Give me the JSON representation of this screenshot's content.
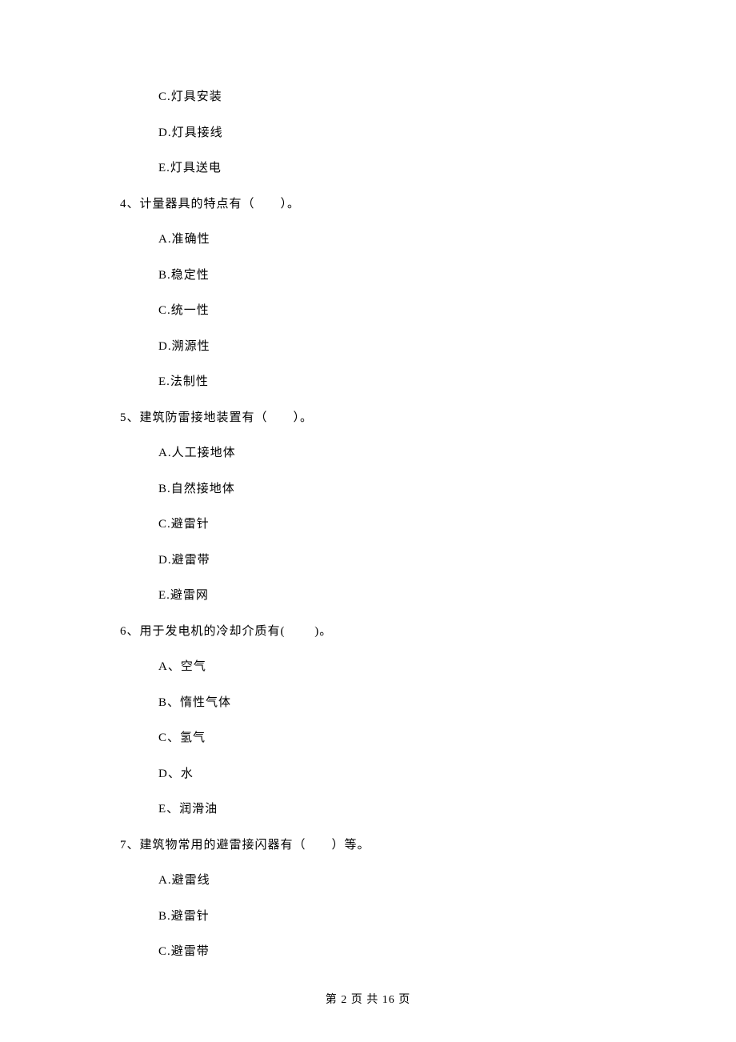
{
  "q3_options": {
    "c": "C.灯具安装",
    "d": "D.灯具接线",
    "e": "E.灯具送电"
  },
  "q4": {
    "text": "4、计量器具的特点有（　　）。",
    "a": "A.准确性",
    "b": "B.稳定性",
    "c": "C.统一性",
    "d": "D.溯源性",
    "e": "E.法制性"
  },
  "q5": {
    "text": "5、建筑防雷接地装置有（　　）。",
    "a": "A.人工接地体",
    "b": "B.自然接地体",
    "c": "C.避雷针",
    "d": "D.避雷带",
    "e": "E.避雷网"
  },
  "q6": {
    "text": "6、用于发电机的冷却介质有(　　 )。",
    "a": "A、空气",
    "b": "B、惰性气体",
    "c": "C、氢气",
    "d": "D、水",
    "e": "E、润滑油"
  },
  "q7": {
    "text": "7、建筑物常用的避雷接闪器有（　　）等。",
    "a": "A.避雷线",
    "b": "B.避雷针",
    "c": "C.避雷带"
  },
  "footer": "第 2 页 共 16 页"
}
